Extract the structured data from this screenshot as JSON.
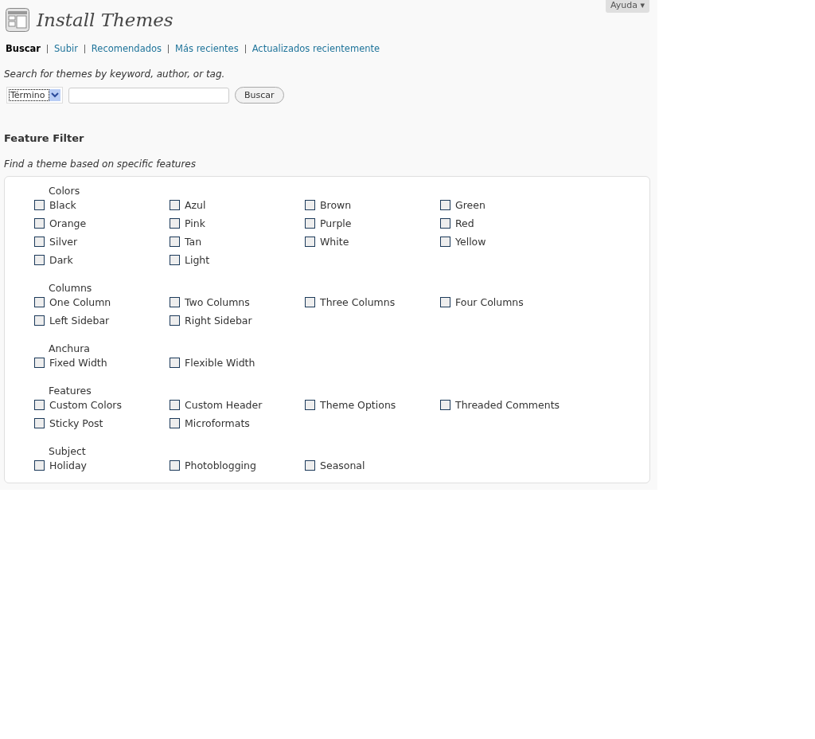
{
  "header": {
    "title": "Install Themes",
    "help_button": "Ayuda ▾"
  },
  "nav": [
    {
      "label": "Buscar",
      "selected": true
    },
    {
      "label": "Subir",
      "selected": false
    },
    {
      "label": "Recomendados",
      "selected": false
    },
    {
      "label": "Más recientes",
      "selected": false
    },
    {
      "label": "Actualizados recientemente",
      "selected": false
    }
  ],
  "search": {
    "hint": "Search for themes by keyword, author, or tag.",
    "type_select": "Término",
    "button": "Buscar"
  },
  "feature_filter": {
    "title": "Feature Filter",
    "description": "Find a theme based on specific features",
    "groups": [
      {
        "legend": "Colors",
        "options": [
          {
            "label": "Black",
            "checked": false
          },
          {
            "label": "Azul",
            "checked": false
          },
          {
            "label": "Brown",
            "checked": false
          },
          {
            "label": "Green",
            "checked": false
          },
          {
            "label": "Orange",
            "checked": false
          },
          {
            "label": "Pink",
            "checked": false
          },
          {
            "label": "Purple",
            "checked": false
          },
          {
            "label": "Red",
            "checked": false
          },
          {
            "label": "Silver",
            "checked": false
          },
          {
            "label": "Tan",
            "checked": false
          },
          {
            "label": "White",
            "checked": false
          },
          {
            "label": "Yellow",
            "checked": false
          },
          {
            "label": "Dark",
            "checked": false
          },
          {
            "label": "Light",
            "checked": false
          }
        ]
      },
      {
        "legend": "Columns",
        "options": [
          {
            "label": "One Column",
            "checked": false
          },
          {
            "label": "Two Columns",
            "checked": false
          },
          {
            "label": "Three Columns",
            "checked": false
          },
          {
            "label": "Four Columns",
            "checked": false
          },
          {
            "label": "Left Sidebar",
            "checked": false
          },
          {
            "label": "Right Sidebar",
            "checked": false
          }
        ]
      },
      {
        "legend": "Anchura",
        "options": [
          {
            "label": "Fixed Width",
            "checked": false
          },
          {
            "label": "Flexible Width",
            "checked": false
          }
        ]
      },
      {
        "legend": "Features",
        "options": [
          {
            "label": "Custom Colors",
            "checked": false
          },
          {
            "label": "Custom Header",
            "checked": false
          },
          {
            "label": "Theme Options",
            "checked": false
          },
          {
            "label": "Threaded Comments",
            "checked": false
          },
          {
            "label": "Sticky Post",
            "checked": false
          },
          {
            "label": "Microformats",
            "checked": false
          }
        ]
      },
      {
        "legend": "Subject",
        "options": [
          {
            "label": "Holiday",
            "checked": false
          },
          {
            "label": "Photoblogging",
            "checked": false
          },
          {
            "label": "Seasonal",
            "checked": false
          }
        ]
      }
    ]
  }
}
